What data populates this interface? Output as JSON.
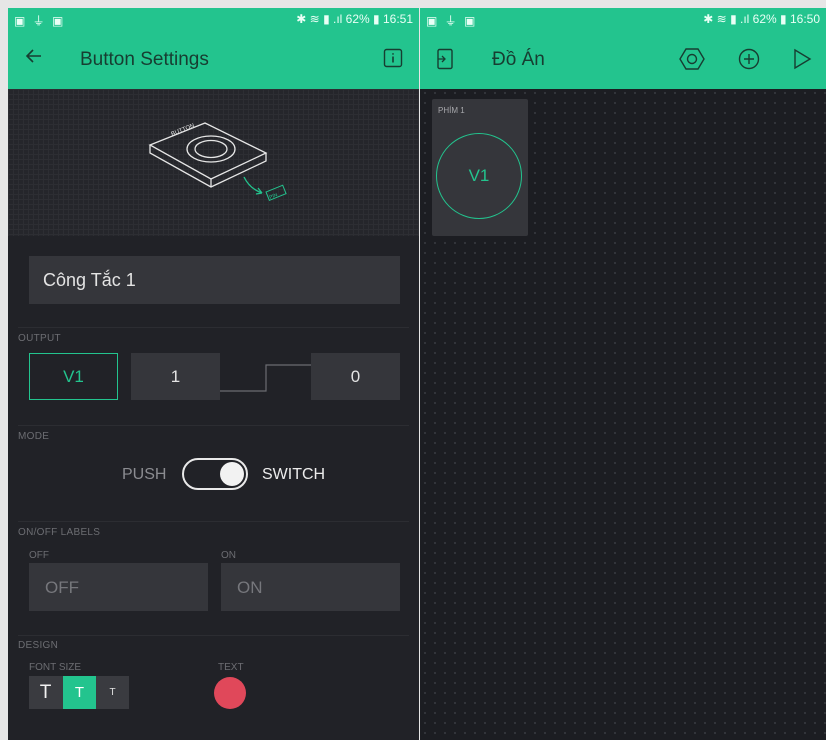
{
  "left": {
    "status": {
      "left_icons": "▣ ⏚ ▣",
      "right_text": "✱ ≋ ▮ .ıl 62% ▮ 16:51"
    },
    "title": "Button Settings",
    "name_value": "Công Tắc 1",
    "output": {
      "section": "OUTPUT",
      "pin": "V1",
      "high": "1",
      "low": "0"
    },
    "mode": {
      "section": "MODE",
      "left": "PUSH",
      "right": "SWITCH",
      "state": "switch"
    },
    "labels": {
      "section": "ON/OFF LABELS",
      "off_label": "OFF",
      "on_label": "ON",
      "off_placeholder": "OFF",
      "on_placeholder": "ON"
    },
    "design": {
      "section": "DESIGN",
      "font_size_label": "FONT SIZE",
      "text_label": "TEXT",
      "sizes": [
        "T",
        "T",
        "T"
      ],
      "selected_size": 1,
      "text_color": "#e0485a"
    }
  },
  "right": {
    "status": {
      "left_icons": "▣ ⏚ ▣",
      "right_text": "✱ ≋ ▮ .ıl 62% ▮ 16:50"
    },
    "title": "Đồ Án",
    "widget": {
      "label": "PHÍM 1",
      "pin": "V1"
    }
  },
  "colors": {
    "accent": "#23c48e",
    "panel": "#212227",
    "field": "#35363b"
  }
}
